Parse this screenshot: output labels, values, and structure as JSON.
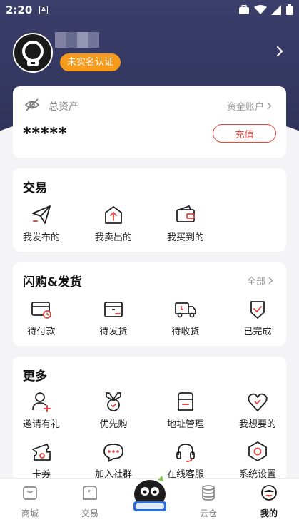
{
  "status_bar": {
    "time": "2:20",
    "a_icon": "A"
  },
  "profile": {
    "verify_badge": "未实名认证"
  },
  "assets": {
    "label": "总资产",
    "fund_link": "资金账户",
    "masked_value": "*****",
    "recharge": "充值"
  },
  "trade": {
    "title": "交易",
    "items": [
      {
        "label": "我发布的",
        "icon": "paper-plane-icon"
      },
      {
        "label": "我卖出的",
        "icon": "box-upload-icon"
      },
      {
        "label": "我买到的",
        "icon": "wallet-icon"
      }
    ]
  },
  "shipping": {
    "title": "闪购&发货",
    "more": "全部",
    "items": [
      {
        "label": "待付款",
        "icon": "card-clock-icon"
      },
      {
        "label": "待发货",
        "icon": "package-icon"
      },
      {
        "label": "待收货",
        "icon": "truck-icon"
      },
      {
        "label": "已完成",
        "icon": "shield-check-icon"
      }
    ]
  },
  "more": {
    "title": "更多",
    "items": [
      {
        "label": "邀请有礼",
        "icon": "user-plus-icon"
      },
      {
        "label": "优先购",
        "icon": "medal-icon"
      },
      {
        "label": "地址管理",
        "icon": "address-icon"
      },
      {
        "label": "我想要的",
        "icon": "heart-icon"
      },
      {
        "label": "卡券",
        "icon": "ticket-icon"
      },
      {
        "label": "加入社群",
        "icon": "chat-bubble-icon"
      },
      {
        "label": "在线客服",
        "icon": "headset-icon"
      },
      {
        "label": "系统设置",
        "icon": "settings-icon"
      }
    ]
  },
  "tabs": [
    {
      "label": "商城",
      "icon": "shop-icon"
    },
    {
      "label": "交易",
      "icon": "trade-icon"
    },
    {
      "label": "",
      "icon": "center-logo-icon"
    },
    {
      "label": "云仓",
      "icon": "database-icon"
    },
    {
      "label": "我的",
      "icon": "profile-face-icon"
    }
  ],
  "colors": {
    "accent": "#e7463f",
    "badge": "#f59a1a",
    "hero": "#33365e"
  }
}
